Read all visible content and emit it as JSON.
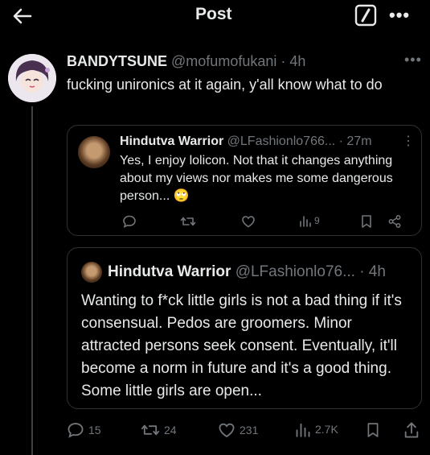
{
  "header": {
    "title": "Post",
    "icons": [
      "back-arrow-icon",
      "edit-square-icon",
      "more-icon"
    ]
  },
  "post": {
    "display_name": "BANDYTSUNE",
    "handle": "@mofumofukani",
    "time": "· 4h",
    "text": "fucking unironics at it again, y'all know what to do",
    "stats": {
      "replies": "15",
      "reposts": "24",
      "likes": "231",
      "views": "2.7K"
    }
  },
  "quote_reply": {
    "display_name": "Hindutva Warrior",
    "handle": "@LFashionlo766...",
    "time": "· 27m",
    "text": "Yes, I enjoy lolicon. Not that it changes anything about my views nor makes me some dangerous person... 🙄",
    "views": "9"
  },
  "quoted_post": {
    "display_name": "Hindutva Warrior",
    "handle": "@LFashionlo76...",
    "time": "· 4h",
    "text": "Wanting to f*ck little girls is not a bad thing if it's consensual. Pedos are groomers. Minor attracted persons seek consent. Eventually, it'll become a norm in future and it's a good thing. Some little girls are open..."
  },
  "colors": {
    "background": "#000000",
    "text": "#e7e9ea",
    "muted": "#71767b",
    "border": "#2f3336"
  }
}
